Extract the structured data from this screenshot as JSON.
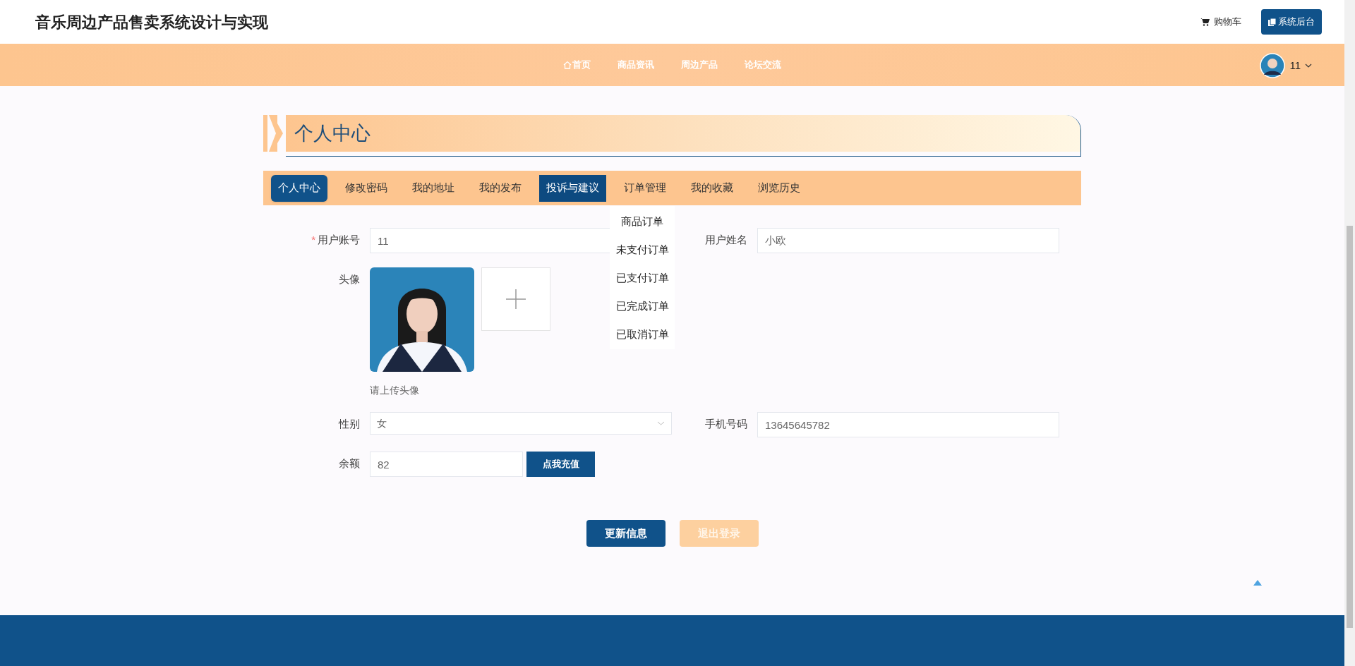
{
  "header": {
    "title": "音乐周边产品售卖系统设计与实现",
    "cart": "购物车",
    "admin_button": "系统后台"
  },
  "nav": {
    "items": [
      {
        "label": "首页",
        "kind": "home"
      },
      {
        "label": "商品资讯",
        "kind": "link"
      },
      {
        "label": "周边产品",
        "kind": "link"
      },
      {
        "label": "论坛交流",
        "kind": "link"
      }
    ],
    "user": "11"
  },
  "banner": {
    "title": "个人中心"
  },
  "tabs": [
    {
      "label": "个人中心",
      "selected": true,
      "hovered": false
    },
    {
      "label": "修改密码",
      "selected": false,
      "hovered": false
    },
    {
      "label": "我的地址",
      "selected": false,
      "hovered": false
    },
    {
      "label": "我的发布",
      "selected": false,
      "hovered": false
    },
    {
      "label": "投诉与建议",
      "selected": false,
      "hovered": true
    },
    {
      "label": "订单管理",
      "selected": false,
      "hovered": false,
      "expanded": true,
      "menu": [
        "商品订单",
        "未支付订单",
        "已支付订单",
        "已完成订单",
        "已取消订单"
      ]
    },
    {
      "label": "我的收藏",
      "selected": false,
      "hovered": false
    },
    {
      "label": "浏览历史",
      "selected": false,
      "hovered": false
    }
  ],
  "form": {
    "rows": [
      [
        {
          "kind": "text",
          "label": "用户账号",
          "required_mark": "*",
          "value": "11"
        },
        {
          "kind": "text",
          "label": "用户姓名",
          "value": "小欧"
        }
      ],
      [
        {
          "label": "头像",
          "hint": "请上传头像"
        }
      ],
      [
        {
          "kind": "select",
          "label": "性别",
          "value": "女"
        },
        {
          "kind": "text",
          "label": "手机号码",
          "value": "13645645782"
        }
      ],
      [
        {
          "kind": "text_button",
          "label": "余额",
          "value": "82",
          "button": "点我充值"
        }
      ]
    ],
    "buttons": [
      {
        "label": "更新信息",
        "kind": "primary"
      },
      {
        "label": "退出登录",
        "kind": "secondary"
      }
    ]
  }
}
